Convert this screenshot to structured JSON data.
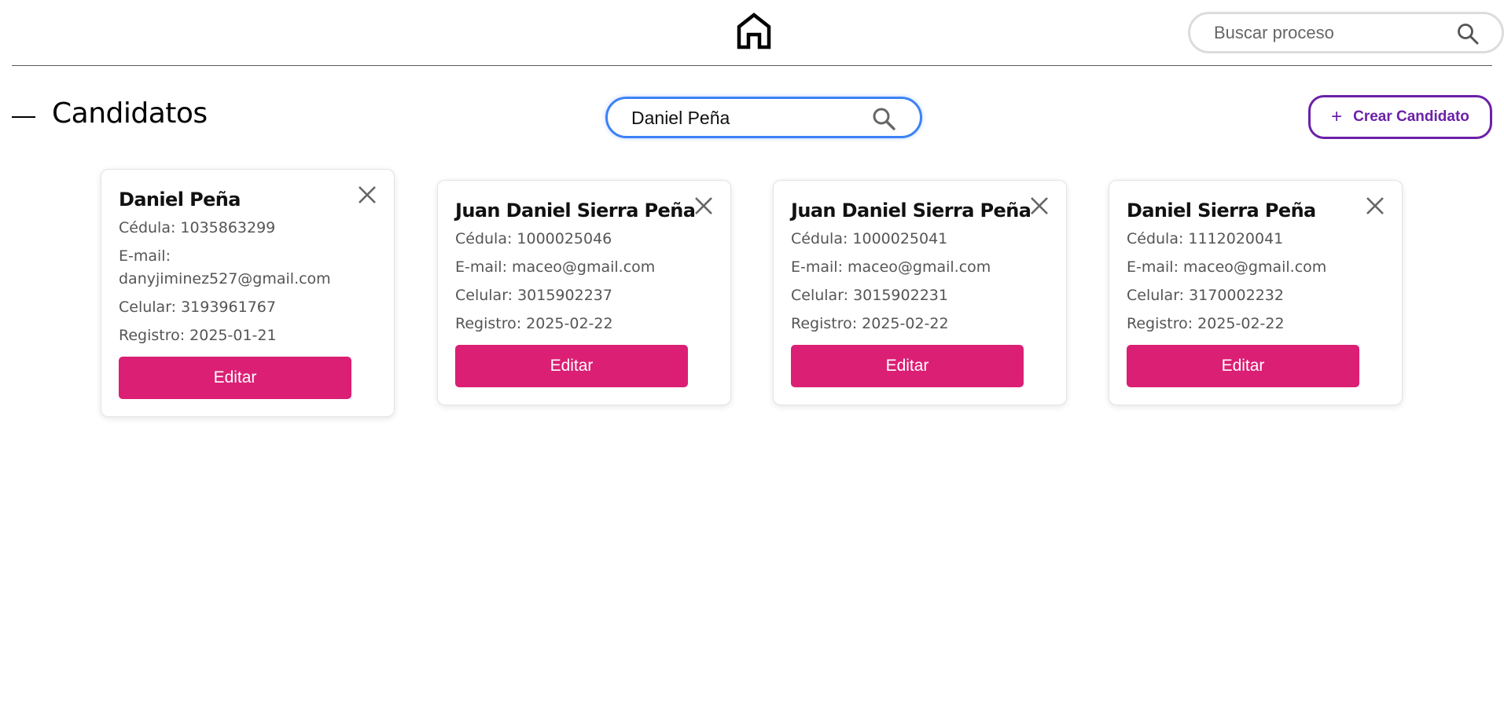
{
  "topbar": {
    "home_icon": "home-icon",
    "search": {
      "placeholder": "Buscar proceso",
      "value": ""
    }
  },
  "header": {
    "title": "Candidatos",
    "search": {
      "value": "Daniel Peña",
      "placeholder": ""
    },
    "create_button": {
      "icon": "+",
      "label": "Crear Candidato"
    }
  },
  "colors": {
    "accent_pink": "#db1f74",
    "accent_purple": "#6b21a8",
    "focus_blue": "#3b82f6"
  },
  "labels": {
    "cedula": "Cédula:",
    "email": "E-mail:",
    "celular": "Celular:",
    "registro": "Registro:",
    "edit": "Editar"
  },
  "candidates": [
    {
      "name": "Daniel Peña",
      "cedula": "1035863299",
      "email": "danyjiminez527@gmail.com",
      "celular": "3193961767",
      "registro": "2025-01-21"
    },
    {
      "name": "Juan Daniel Sierra Peña",
      "cedula": "1000025046",
      "email": "maceo@gmail.com",
      "celular": "3015902237",
      "registro": "2025-02-22"
    },
    {
      "name": "Juan Daniel Sierra Peña",
      "cedula": "1000025041",
      "email": "maceo@gmail.com",
      "celular": "3015902231",
      "registro": "2025-02-22"
    },
    {
      "name": "Daniel Sierra Peña",
      "cedula": "1112020041",
      "email": "maceo@gmail.com",
      "celular": "3170002232",
      "registro": "2025-02-22"
    }
  ]
}
